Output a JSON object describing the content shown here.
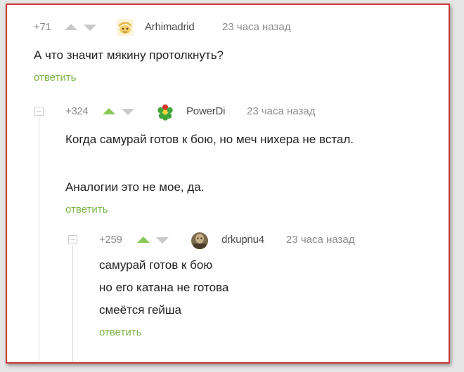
{
  "comments": [
    {
      "rating": "+71",
      "author": "Arhimadrid",
      "time": "23 часа назад",
      "lines": [
        "А что значит мякину протолкнуть?"
      ],
      "reply_label": "ответить",
      "avatar_icon": "cartoon-face-avatar",
      "upvoted": false
    },
    {
      "rating": "+324",
      "author": "PowerDi",
      "time": "23 часа назад",
      "lines": [
        "Когда самурай готов к бою, но меч нихера не встал.",
        "Аналогии это не мое, да."
      ],
      "reply_label": "ответить",
      "avatar_icon": "icq-flower-avatar",
      "upvoted": true
    },
    {
      "rating": "+259",
      "author": "drkupnu4",
      "time": "23 часа назад",
      "lines": [
        "самурай готов к бою",
        "но его катана не готова",
        "смеётся гейша"
      ],
      "reply_label": "ответить",
      "avatar_icon": "photo-avatar",
      "upvoted": true
    }
  ],
  "colors": {
    "frame_border": "#c63a37",
    "reply_link": "#7bb548",
    "upvote_active": "#8ac858",
    "vote_inactive": "#c9c9c9"
  }
}
